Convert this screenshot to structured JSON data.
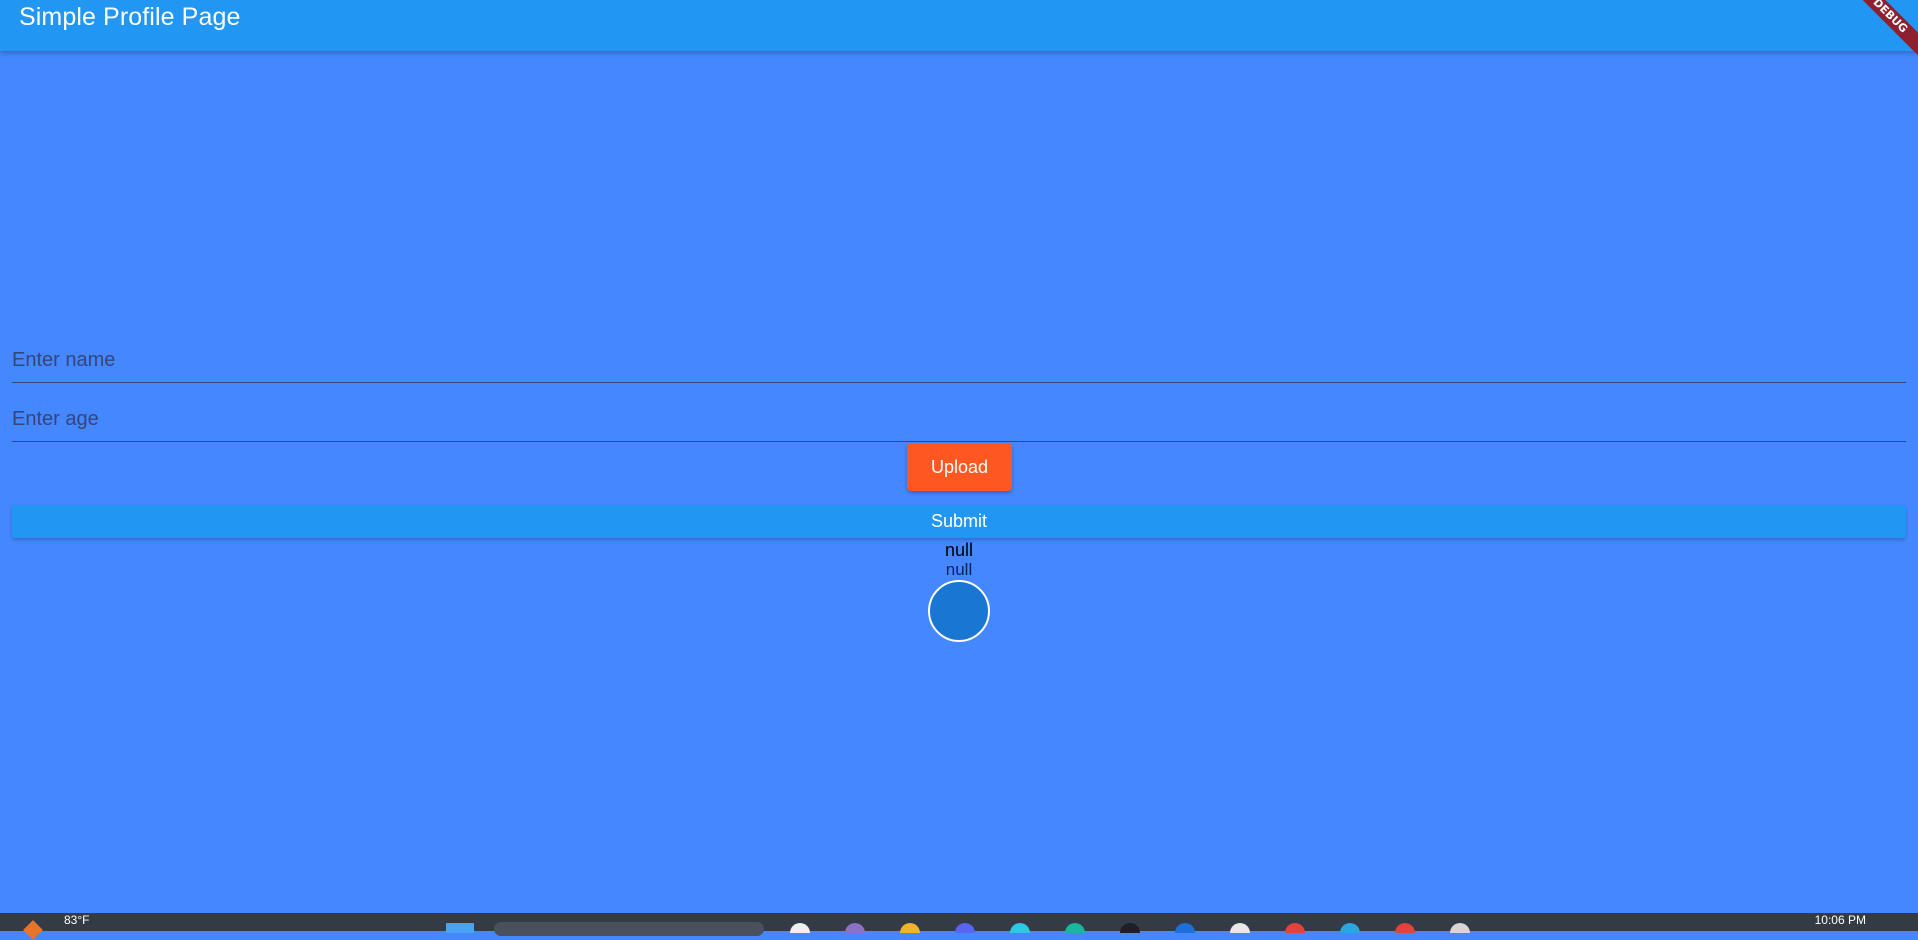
{
  "appbar": {
    "title": "Simple Profile Page",
    "debug_label": "DEBUG"
  },
  "form": {
    "name_placeholder": "Enter name",
    "age_placeholder": "Enter age",
    "upload_label": "Upload",
    "submit_label": "Submit"
  },
  "result": {
    "name": "null",
    "age": "null"
  },
  "taskbar": {
    "temperature": "83°F",
    "time": "10:06 PM",
    "apps": [
      {
        "name": "file-explorer-icon",
        "color": "#f0f0f0"
      },
      {
        "name": "app-icon-2",
        "color": "#8a72c8"
      },
      {
        "name": "app-icon-3",
        "color": "#f0b429"
      },
      {
        "name": "app-icon-4",
        "color": "#5865f2"
      },
      {
        "name": "app-icon-5",
        "color": "#2ec7e6"
      },
      {
        "name": "app-icon-6",
        "color": "#18b6a0"
      },
      {
        "name": "app-icon-7",
        "color": "#1b1f27"
      },
      {
        "name": "app-icon-8",
        "color": "#1e6fd9"
      },
      {
        "name": "app-icon-9",
        "color": "#e8e8e8"
      },
      {
        "name": "app-icon-10",
        "color": "#e0443a"
      },
      {
        "name": "app-icon-11",
        "color": "#2aa6e0"
      },
      {
        "name": "app-icon-12",
        "color": "#e0443a"
      },
      {
        "name": "app-icon-13",
        "color": "#d6d6d6"
      }
    ]
  },
  "colors": {
    "background": "#4487ff",
    "appbar": "#2196f3",
    "upload_button": "#ff5722",
    "submit_button": "#2196f3",
    "avatar": "#1976d2"
  }
}
